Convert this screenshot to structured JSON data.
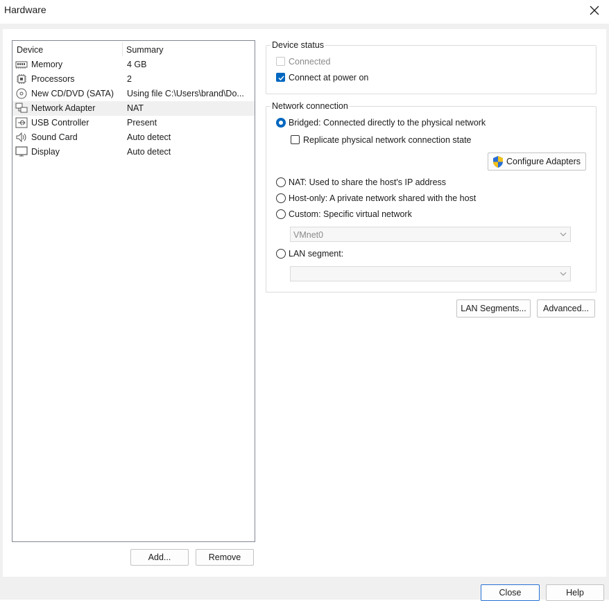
{
  "window": {
    "title": "Hardware"
  },
  "device_list": {
    "headers": {
      "device": "Device",
      "summary": "Summary"
    },
    "rows": [
      {
        "name": "Memory",
        "summary": "4 GB",
        "icon": "memory-icon"
      },
      {
        "name": "Processors",
        "summary": "2",
        "icon": "processor-icon"
      },
      {
        "name": "New CD/DVD (SATA)",
        "summary": "Using file C:\\Users\\brand\\Do...",
        "icon": "cd-dvd-icon"
      },
      {
        "name": "Network Adapter",
        "summary": "NAT",
        "icon": "network-adapter-icon",
        "selected": true
      },
      {
        "name": "USB Controller",
        "summary": "Present",
        "icon": "usb-icon"
      },
      {
        "name": "Sound Card",
        "summary": "Auto detect",
        "icon": "speaker-icon"
      },
      {
        "name": "Display",
        "summary": "Auto detect",
        "icon": "monitor-icon"
      }
    ],
    "add_label": "Add...",
    "remove_label": "Remove"
  },
  "device_status": {
    "title": "Device status",
    "connected_label": "Connected",
    "connected_checked": false,
    "connected_enabled": false,
    "power_on_label": "Connect at power on",
    "power_on_checked": true
  },
  "network_connection": {
    "title": "Network connection",
    "bridged_label": "Bridged: Connected directly to the physical network",
    "replicate_label": "Replicate physical network connection state",
    "configure_label": "Configure Adapters",
    "nat_label": "NAT: Used to share the host's IP address",
    "hostonly_label": "Host-only: A private network shared with the host",
    "custom_label": "Custom: Specific virtual network",
    "custom_value": "VMnet0",
    "lan_label": "LAN segment:",
    "lan_value": "",
    "selected": "bridged"
  },
  "buttons": {
    "lan_segments": "LAN Segments...",
    "advanced": "Advanced...",
    "close": "Close",
    "help": "Help"
  },
  "colors": {
    "accent": "#0067c0",
    "selected_row": "#f0f0f0",
    "shield_blue": "#2a6fd6",
    "shield_yellow": "#f2c21b"
  }
}
